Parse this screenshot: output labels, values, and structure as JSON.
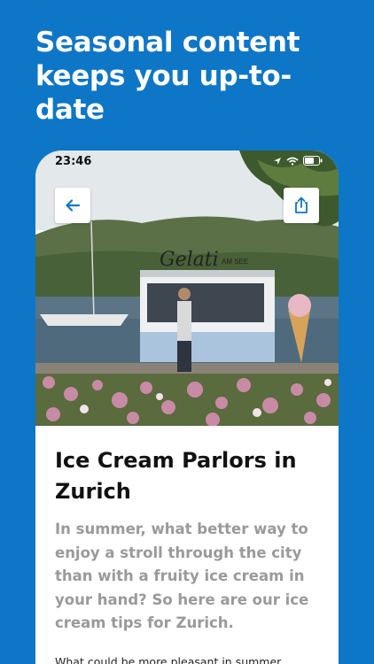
{
  "headline": "Seasonal content keeps you up-to-date",
  "status_bar": {
    "time": "23:46",
    "icons": [
      "location-arrow-icon",
      "wifi-icon",
      "battery-icon"
    ]
  },
  "hero": {
    "sign_text": "Gelati",
    "sign_subtext": "AM SEE"
  },
  "buttons": {
    "back_icon": "arrow-left-icon",
    "share_icon": "share-icon"
  },
  "article": {
    "title": "Ice Cream Parlors in Zurich",
    "lead": "In summer, what better way to enjoy a stroll through the city than with a fruity ice cream in your hand? So here are our ice cream tips for Zurich.",
    "body": "What could be more pleasant in summer"
  },
  "colors": {
    "background": "#0e76c6",
    "accent": "#0e76c6",
    "card": "#ffffff",
    "lead_text": "#9a9a9a"
  }
}
